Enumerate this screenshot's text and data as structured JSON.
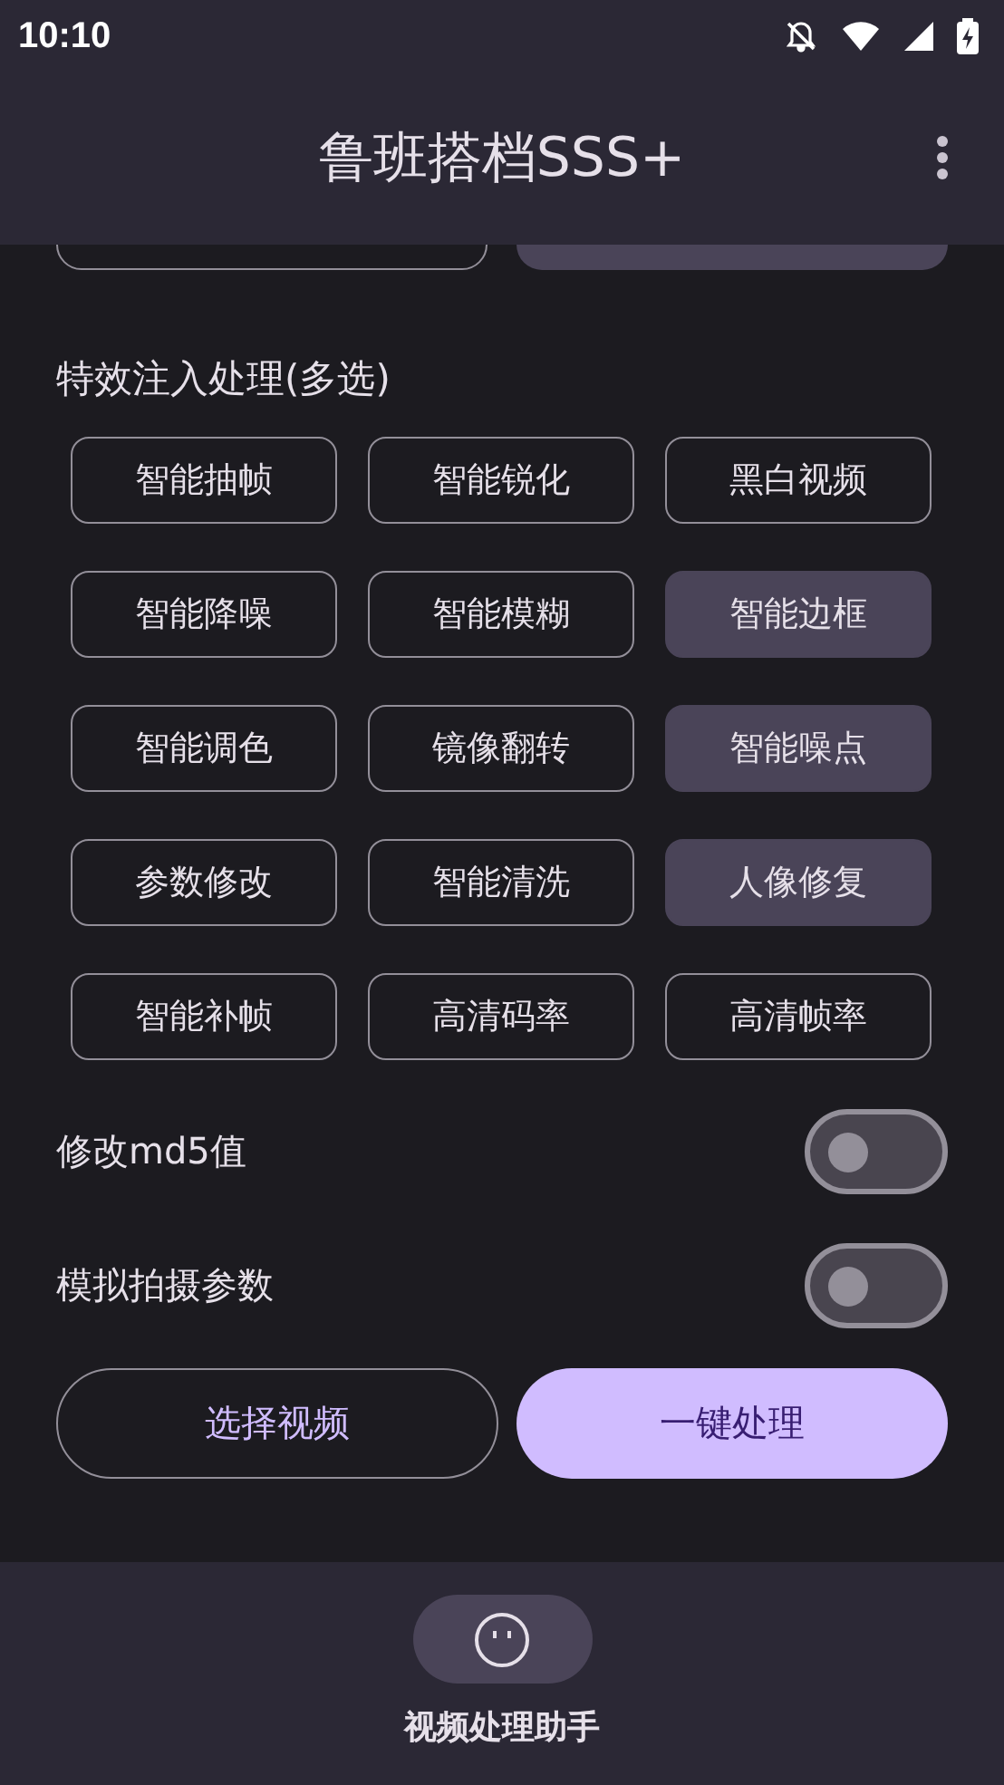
{
  "status_bar": {
    "time": "10:10"
  },
  "app_bar": {
    "title": "鲁班搭档SSS+"
  },
  "top_options": [
    {
      "selected": false
    },
    {
      "selected": true
    }
  ],
  "effects": {
    "heading": "特效注入处理(多选)",
    "items": [
      {
        "label": "智能抽帧",
        "selected": false
      },
      {
        "label": "智能锐化",
        "selected": false
      },
      {
        "label": "黑白视频",
        "selected": false
      },
      {
        "label": "智能降噪",
        "selected": false
      },
      {
        "label": "智能模糊",
        "selected": false
      },
      {
        "label": "智能边框",
        "selected": true
      },
      {
        "label": "智能调色",
        "selected": false
      },
      {
        "label": "镜像翻转",
        "selected": false
      },
      {
        "label": "智能噪点",
        "selected": true
      },
      {
        "label": "参数修改",
        "selected": false
      },
      {
        "label": "智能清洗",
        "selected": false
      },
      {
        "label": "人像修复",
        "selected": true
      },
      {
        "label": "智能补帧",
        "selected": false
      },
      {
        "label": "高清码率",
        "selected": false
      },
      {
        "label": "高清帧率",
        "selected": false
      }
    ]
  },
  "switches": [
    {
      "label": "修改md5值",
      "on": false
    },
    {
      "label": "模拟拍摄参数",
      "on": false
    }
  ],
  "buttons": [
    {
      "label": "选择视频",
      "kind": "outlined"
    },
    {
      "label": "一键处理",
      "kind": "filled"
    }
  ],
  "bottom_nav": [
    {
      "label": "视频处理助手",
      "selected": true
    }
  ]
}
